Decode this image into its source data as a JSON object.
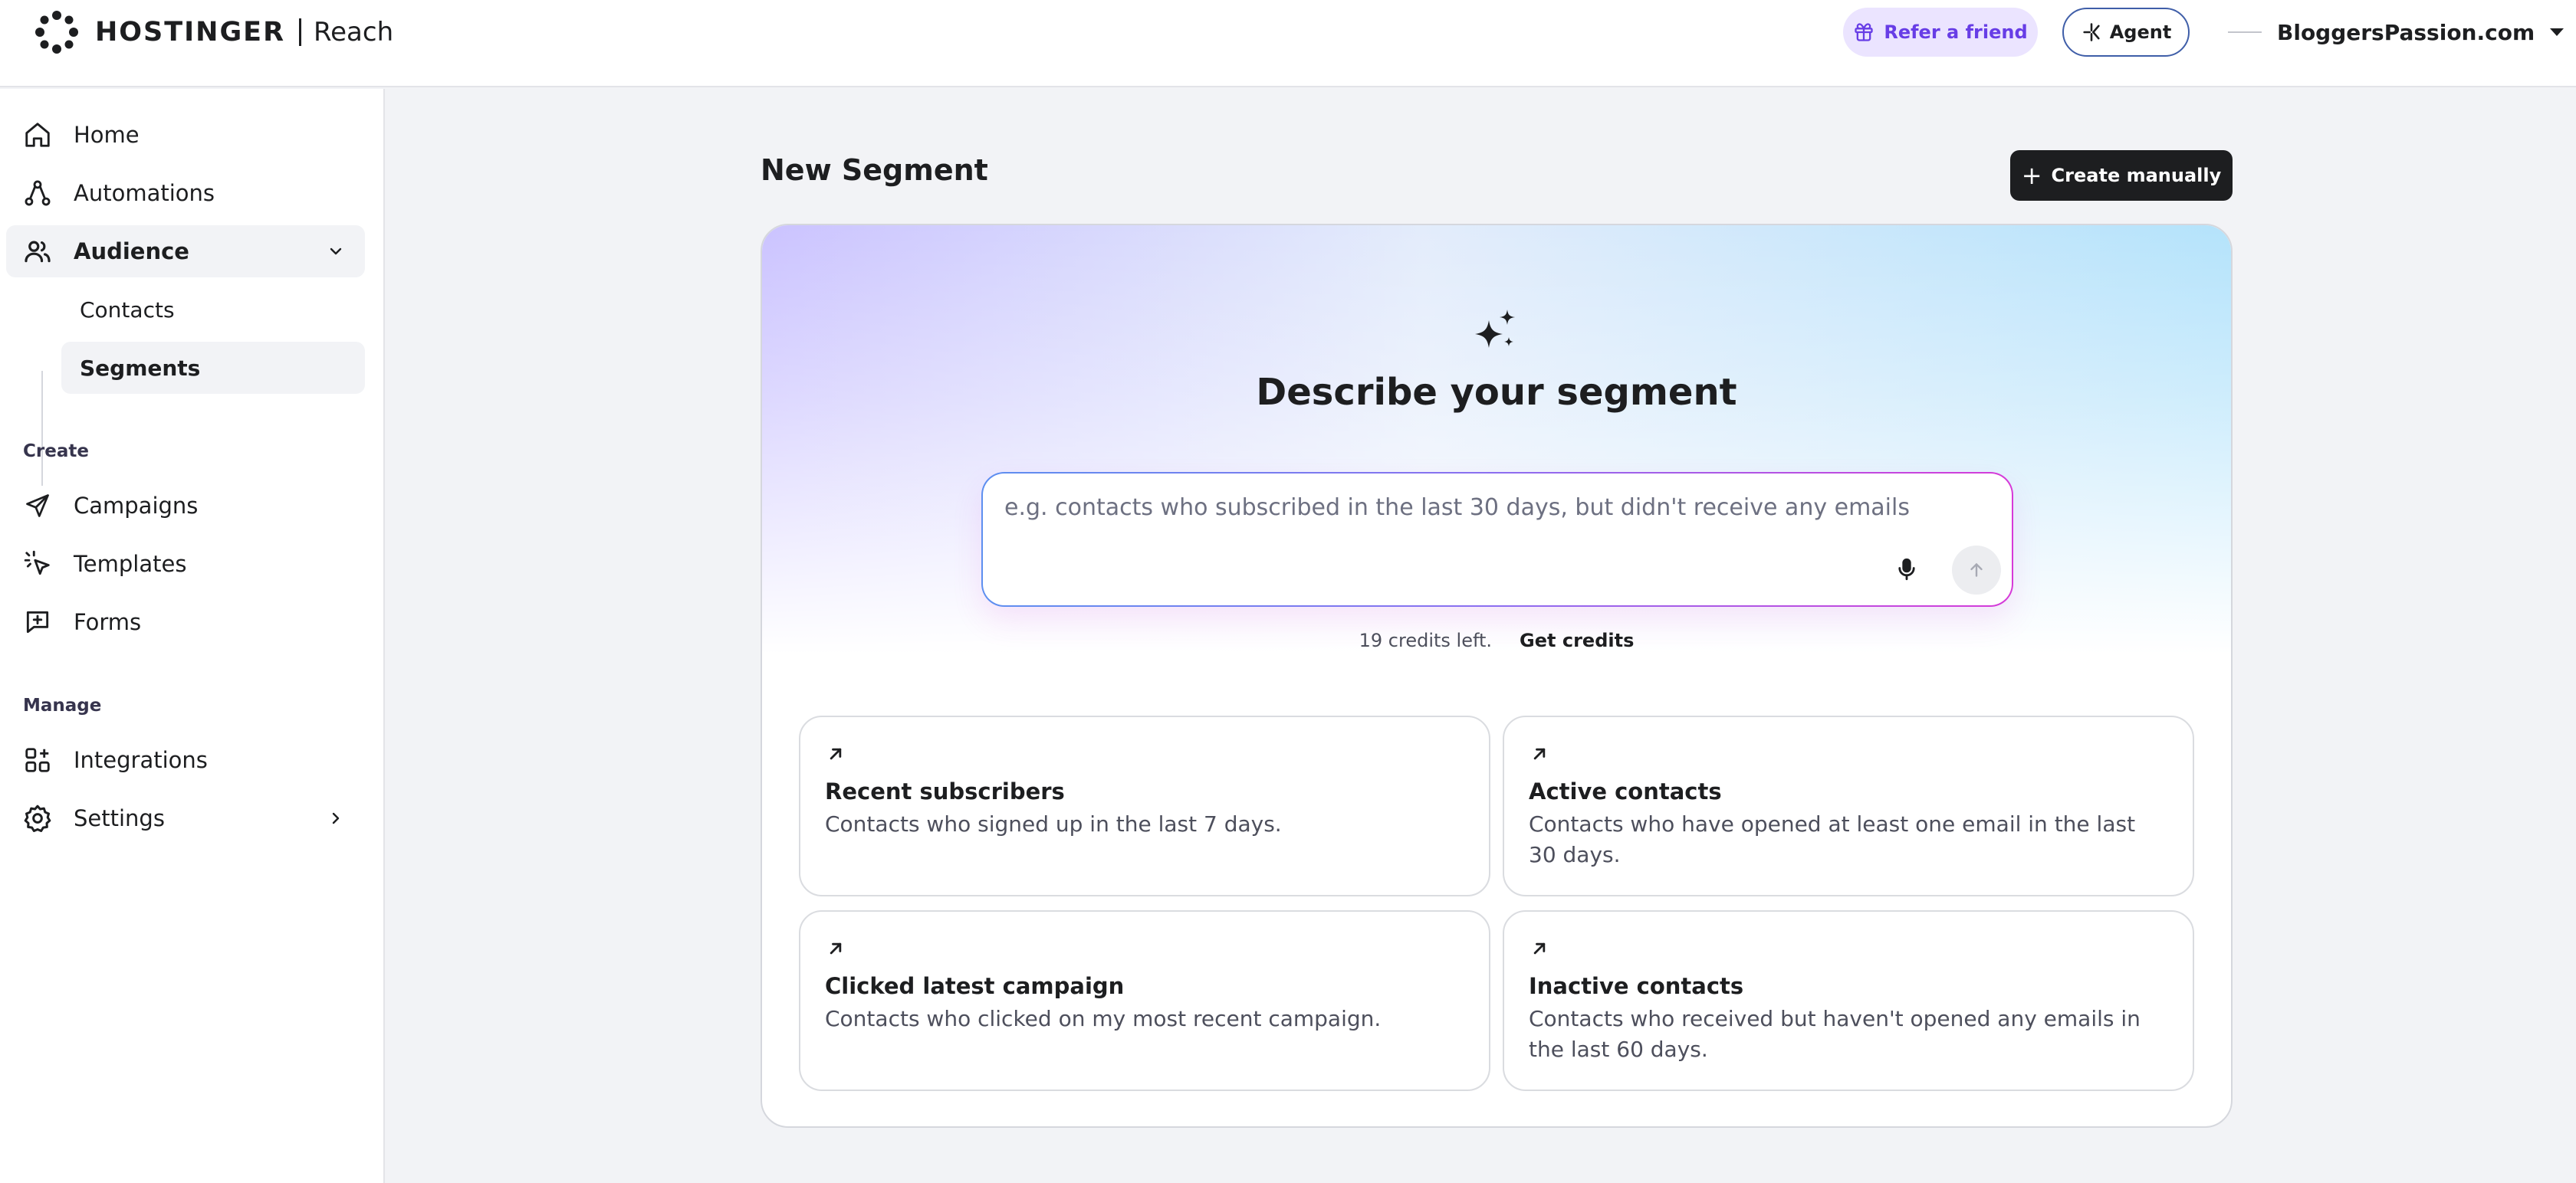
{
  "header": {
    "brand": "HOSTINGER",
    "product": "Reach",
    "refer_label": "Refer a friend",
    "agent_label": "Agent",
    "site_name": "BloggersPassion.com",
    "accent_color": "#673de6"
  },
  "sidebar": {
    "home": "Home",
    "automations": "Automations",
    "audience": "Audience",
    "contacts": "Contacts",
    "segments": "Segments",
    "create_section": "Create",
    "campaigns": "Campaigns",
    "templates": "Templates",
    "forms": "Forms",
    "manage_section": "Manage",
    "integrations": "Integrations",
    "settings": "Settings"
  },
  "main": {
    "page_title": "New Segment",
    "create_manually": "Create manually",
    "describe_title": "Describe your segment",
    "prompt_placeholder": "e.g. contacts who subscribed in the last 30 days, but didn't receive any emails",
    "prompt_value": "",
    "credits_text": "19 credits left.",
    "get_credits": "Get credits",
    "suggestions": [
      {
        "title": "Recent subscribers",
        "description": "Contacts who signed up in the last 7 days."
      },
      {
        "title": "Active contacts",
        "description": "Contacts who have opened at least one email in the last 30 days."
      },
      {
        "title": "Clicked latest campaign",
        "description": "Contacts who clicked on my most recent campaign."
      },
      {
        "title": "Inactive contacts",
        "description": "Contacts who received but haven't opened any emails in the last 60 days."
      }
    ]
  }
}
